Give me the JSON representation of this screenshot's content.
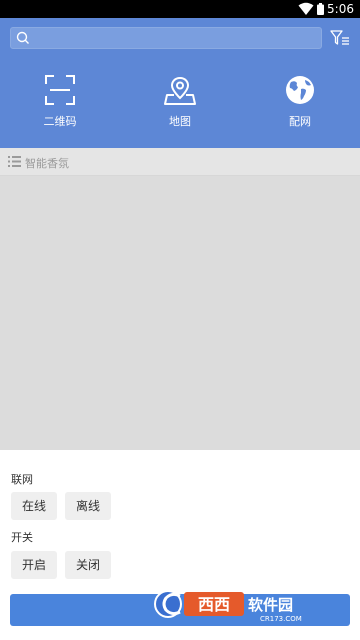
{
  "status_bar": {
    "time": "5:06"
  },
  "search": {
    "placeholder": "",
    "value": ""
  },
  "quick_menu": [
    {
      "label": "二维码",
      "icon": "qr-scan-icon"
    },
    {
      "label": "地图",
      "icon": "map-pin-icon"
    },
    {
      "label": "配网",
      "icon": "globe-icon"
    }
  ],
  "section": {
    "title": "智能香氛"
  },
  "network": {
    "title": "联网",
    "online_label": "在线",
    "offline_label": "离线"
  },
  "switch": {
    "title": "开关",
    "on_label": "开启",
    "off_label": "关闭"
  },
  "submit": {
    "label": ""
  },
  "watermark": {
    "brand": "西西软件园",
    "url": "CR173.COM"
  },
  "colors": {
    "header": "#5d87d6",
    "content_bg": "#dcdcdc",
    "button": "#4a84dc",
    "chip_bg": "#efefef"
  }
}
